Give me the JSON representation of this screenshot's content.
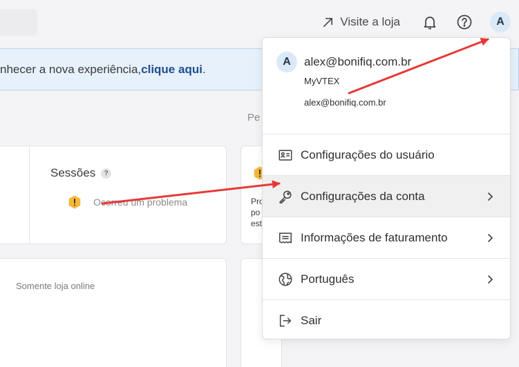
{
  "topbar": {
    "visit_store_label": "Visite a loja",
    "avatar_initial": "A"
  },
  "banner": {
    "text_prefix": "nhecer a nova experiência, ",
    "link_label": "clique aqui",
    "text_suffix": "."
  },
  "background": {
    "faded_label": "Pe",
    "sessions_title": "Sessões",
    "help_mark": "?",
    "problem_text": "Ocorreu um problema",
    "online_only_label": "Somente loja online",
    "partial_lines": [
      "Pro",
      "po",
      "est"
    ]
  },
  "account_menu": {
    "avatar_initial": "A",
    "email": "alex@bonifiq.com.br",
    "account_name": "MyVTEX",
    "login_email": "alex@bonifiq.com.br",
    "items": [
      {
        "label": "Configurações do usuário",
        "icon": "user-card-icon",
        "has_submenu": false
      },
      {
        "label": "Configurações da conta",
        "icon": "key-icon",
        "has_submenu": true
      },
      {
        "label": "Informações de faturamento",
        "icon": "invoice-icon",
        "has_submenu": true
      },
      {
        "label": "Português",
        "icon": "globe-icon",
        "has_submenu": true
      },
      {
        "label": "Sair",
        "icon": "logout-icon",
        "has_submenu": false
      }
    ]
  },
  "annotations": {
    "arrow_color": "#e53935"
  },
  "colors": {
    "link": "#1f4e8f",
    "banner_bg": "#e7f1fb",
    "avatar_bg": "#dbe9f7",
    "warning": "#f5b83d"
  }
}
